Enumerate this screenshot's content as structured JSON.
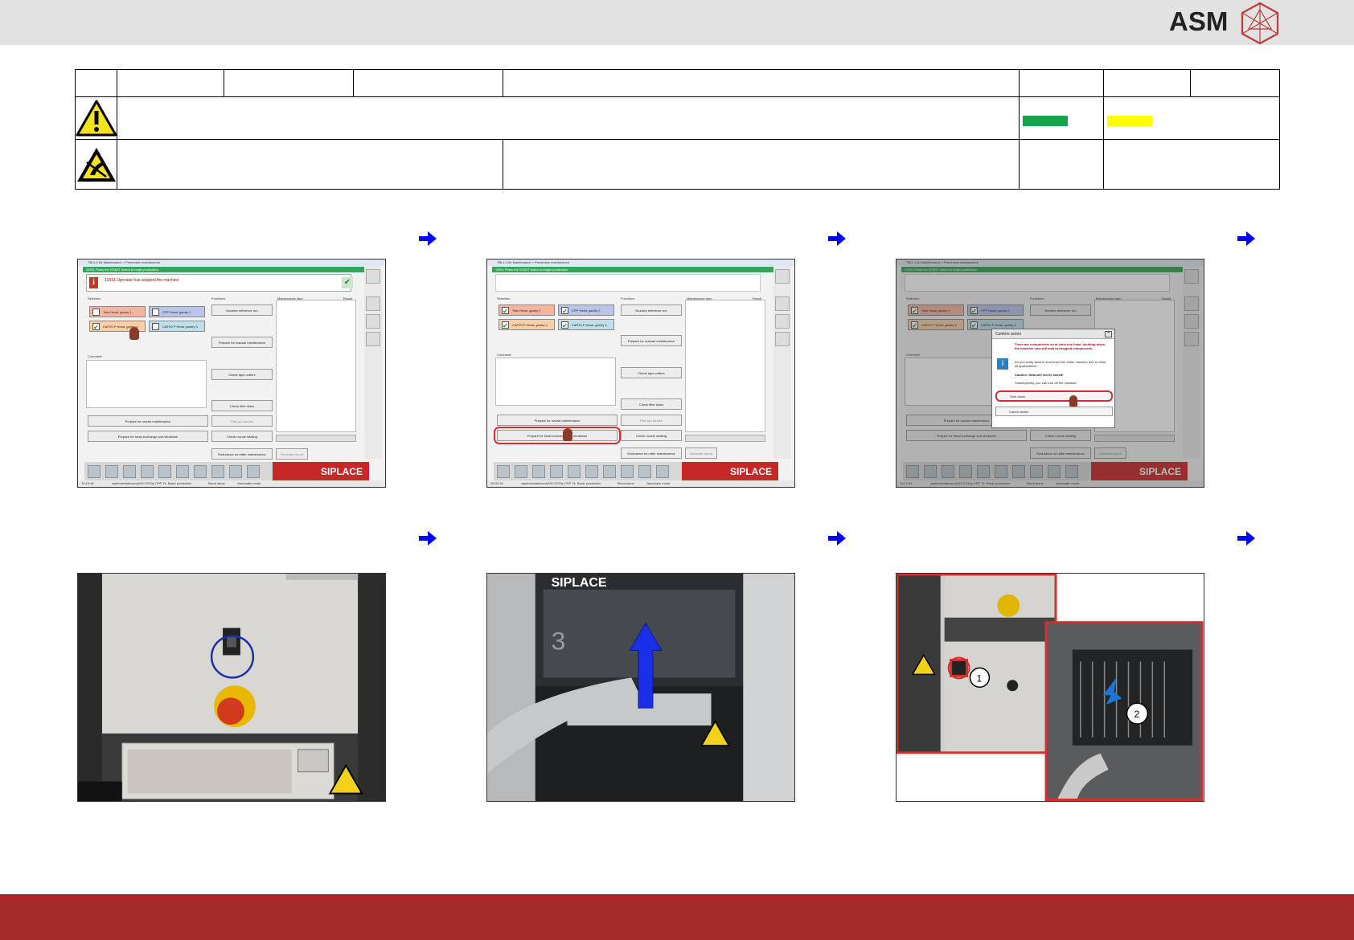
{
  "brand": {
    "logo_text": "ASM"
  },
  "colors": {
    "top_bar": "#e2e2e3",
    "bottom_bar": "#a52a2a",
    "arrow": "#0000ff",
    "green_swatch": "#16a34a",
    "yellow_swatch": "#ffff00"
  },
  "header_table": {
    "row1_cells": [
      "",
      "",
      "",
      "",
      "",
      "",
      "",
      ""
    ],
    "row2_cells": [
      "",
      "",
      ""
    ],
    "row3_cells": [
      "",
      "",
      "",
      ""
    ]
  },
  "screens": {
    "title": "TBL1.0.84 Maintenance > Preventive maintenance",
    "green_banner": "11901 Press the START button to begin production",
    "message": "12551 Operator has stopped the machine",
    "selection_header": "Selection",
    "functions_header": "Functions",
    "maintenance_header_a": "Maintenance step",
    "result_header": "Result",
    "comment_label": "Comment:",
    "heads": [
      "Twin Head, gantry 1",
      "CPP Head, gantry 2",
      "C&P20 P Head, gantry 4",
      "C&P20 P Head, gantry 3"
    ],
    "function_buttons": [
      "Nozzles reference run",
      "Prepare for manual maintenance",
      "Check tape cutters",
      "Check filter disks",
      "Pick up nozzles",
      "Check nozzle seating",
      "Endurance run after maintenance",
      "Generate report"
    ],
    "left_buttons": [
      "Prepare for nozzle maintenance",
      "Prepare for head exchange and shutdown"
    ],
    "brand": "SIPLACE",
    "status_left": "capitovtestatuwon|245 CP20p CPP Tk",
    "status_mode": "Basic production",
    "status_standalone": "Stand alone",
    "status_auto": "Automatic mode",
    "time_1": "10:16:18",
    "time_2": "10:00:18",
    "time_3": "10:21:44"
  },
  "dialog": {
    "title": "Confirm action",
    "warning": "There are components on at least one head, shutting down the machine now will lead to dropped components.",
    "question": "Do you really want to shut down the entire machine and to close all applications?",
    "caution": "Caution: Data will not be saved!",
    "subsequent": "Subsequently, you can turn off the machine.",
    "shutdown": "Shut down",
    "cancel": "Cancel action"
  },
  "photos": {
    "siplace_label": "SIPLACE",
    "callout_1": "1",
    "callout_2": "2",
    "digit_3": "3"
  },
  "icons": [
    "warning-triangle-icon",
    "esd-warning-icon",
    "arrow-right-icon",
    "info-icon",
    "check-icon",
    "hand-pointer-icon",
    "up-arrow-icon"
  ]
}
